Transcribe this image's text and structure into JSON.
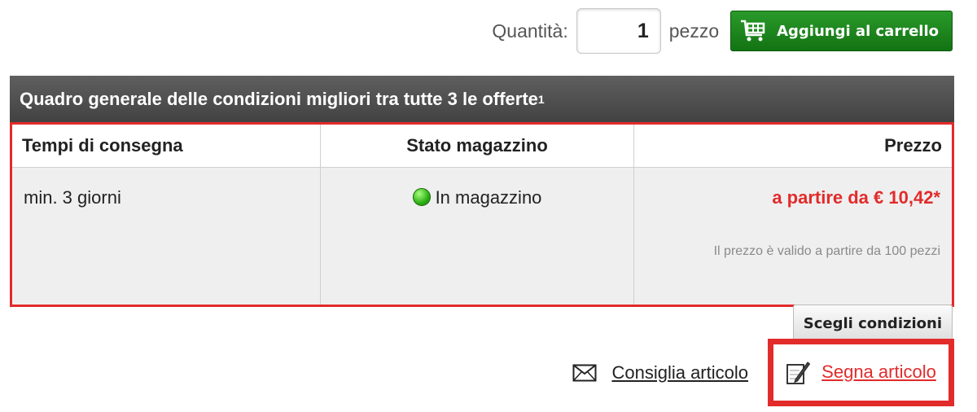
{
  "quantity": {
    "label": "Quantità:",
    "value": "1",
    "unit": "pezzo"
  },
  "cart_button": {
    "label": "Aggiungi al carrello",
    "icon": "shopping-cart-icon"
  },
  "offers": {
    "header_text": "Quadro generale delle condizioni migliori tra tutte 3 le offerte",
    "header_footnote": "1",
    "columns": [
      "Tempi di consegna",
      "Stato magazzino",
      "Prezzo"
    ],
    "row": {
      "delivery": "min. 3 giorni",
      "stock": "In magazzino",
      "stock_status_color": "#2db013",
      "price": "a partire da € 10,42*",
      "price_note": "Il prezzo è valido a partire da 100 pezzi"
    }
  },
  "choose_button": {
    "label": "Scegli condizioni"
  },
  "links": {
    "recommend": {
      "label": "Consiglia articolo",
      "icon": "envelope-icon"
    },
    "mark": {
      "label": "Segna articolo",
      "icon": "pencil-icon"
    }
  },
  "colors": {
    "accent_red": "#e22b2b",
    "cart_green": "#1f8a1f",
    "header_gray": "#4f4f4f"
  }
}
